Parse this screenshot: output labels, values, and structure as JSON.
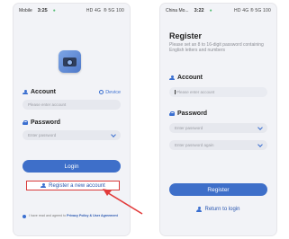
{
  "left_phone": {
    "status": {
      "carrier": "Mobile",
      "time": "3:25",
      "right": " HD 4G  ® 5G 100"
    },
    "account_label": "Account",
    "device_label": "Device",
    "account_placeholder": "Please enter account",
    "password_label": "Password",
    "password_placeholder": "Enter password",
    "login_button": "Login",
    "register_link": "Register a new account",
    "agreement_text": "I have read and agreed to",
    "agreement_link": "Privacy Policy & User Agreement"
  },
  "right_phone": {
    "status": {
      "carrier": "China Mo...",
      "time": "3:22",
      "right": "HD 4G ® 5G 100"
    },
    "title": "Register",
    "description": "Please set an 8 to 16-digit password containing English letters and numbers",
    "account_label": "Account",
    "account_placeholder": "Please enter account",
    "password_label": "Password",
    "password_placeholder": "Enter password",
    "password_again_placeholder": "Enter password again",
    "register_button": "Register",
    "return_link": "Return to login"
  },
  "colors": {
    "accent": "#3e6fc9",
    "highlight": "#d83a3a",
    "background": "#f2f3f7"
  }
}
